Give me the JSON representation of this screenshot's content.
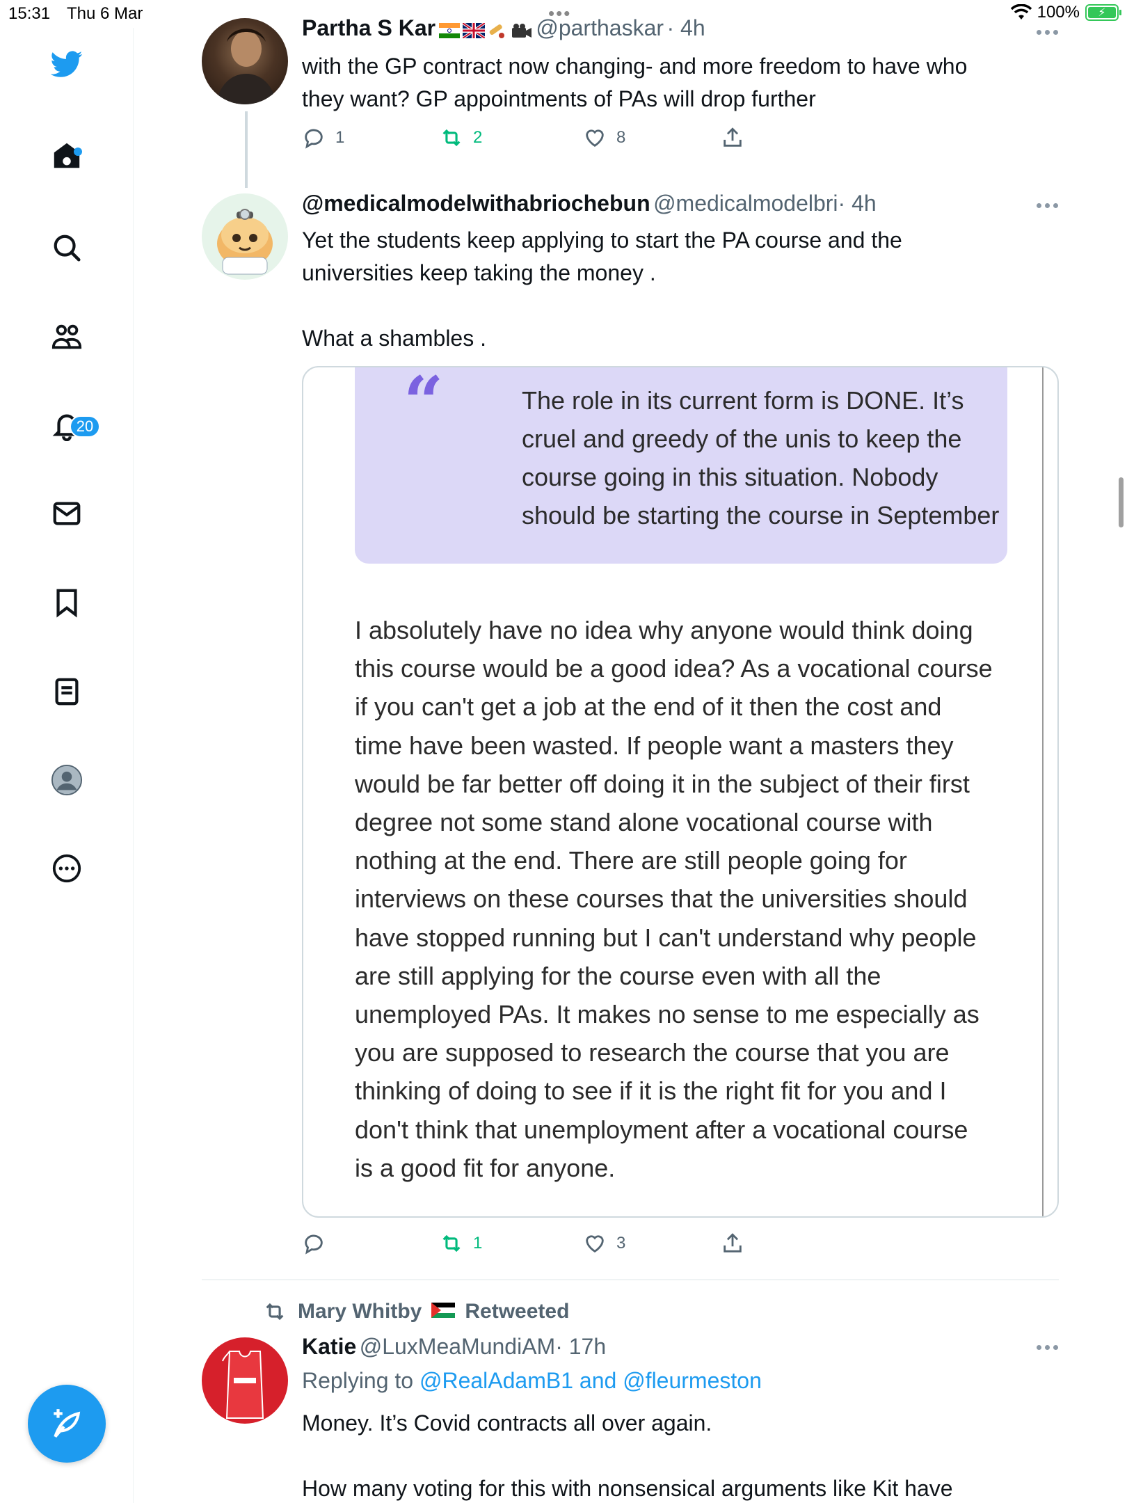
{
  "status_bar": {
    "time": "15:31",
    "date": "Thu 6 Mar",
    "battery": "100%"
  },
  "sidebar": {
    "notifications_count": "20",
    "items": [
      {
        "icon": "twitter-bird-icon"
      },
      {
        "icon": "home-icon"
      },
      {
        "icon": "search-icon"
      },
      {
        "icon": "communities-icon"
      },
      {
        "icon": "notifications-bell-icon"
      },
      {
        "icon": "messages-icon"
      },
      {
        "icon": "bookmark-icon"
      },
      {
        "icon": "lists-icon"
      },
      {
        "icon": "profile-icon"
      },
      {
        "icon": "more-icon"
      }
    ],
    "compose_icon": "compose-feather-icon"
  },
  "tweet1": {
    "name": "Partha S Kar",
    "handle": "@parthaskar",
    "time": "· 4h",
    "lines": [
      "with the GP contract now changing- and more freedom to have who",
      "they want? GP appointments of PAs will drop further"
    ],
    "replies": "1",
    "retweets": "2",
    "likes": "8"
  },
  "tweet2": {
    "name": "@medicalmodelwithabriochebun",
    "handle": "@medicalmodelbri",
    "time": "· 4h",
    "lines": [
      "Yet the students keep applying to start the PA course and the",
      "universities keep taking the money ."
    ],
    "line3": "What a shambles .",
    "quote_highlight": [
      "The role in its current form is DONE. It’s",
      "cruel and greedy of the unis to keep the",
      "course going in this situation. Nobody",
      "should be starting the course in September"
    ],
    "quote_body": [
      "I absolutely have no idea why anyone would think doing",
      "this course would be a good idea? As a vocational course",
      "if you can't get a job at the end of it then the cost and",
      "time have been wasted. If people want a masters they",
      "would be far better off doing it in the subject of their first",
      "degree not some stand alone vocational course with",
      "nothing at the end. There are still people going for",
      "interviews on these courses that the universities should",
      "have stopped running but I can't understand why people",
      "are still applying for the course even with all the",
      "unemployed PAs. It makes no sense to me especially as",
      "you are supposed to research the course that you are",
      "thinking of doing to see if it is the right fit for you and I",
      "don't think that unemployment after a vocational course",
      "is a good fit for anyone."
    ],
    "retweets": "1",
    "likes": "3"
  },
  "tweet3": {
    "retweeted_by": "Mary Whitby",
    "retweeted_label": "Retweeted",
    "name": "Katie",
    "handle": "@LuxMeaMundiAM",
    "time": "· 17h",
    "replying_prefix": "Replying to",
    "replying_to1": "@RealAdamB1",
    "replying_and": "and",
    "replying_to2": "@fleurmeston",
    "line1": "Money. It’s Covid contracts all over again.",
    "line2": "How many voting for this with nonsensical arguments like Kit have"
  },
  "colors": {
    "accent": "#1d9bf0",
    "retweet_green": "#00ba7c",
    "quote_bg": "#dcd8f7",
    "quote_mark": "#7b62e0"
  }
}
